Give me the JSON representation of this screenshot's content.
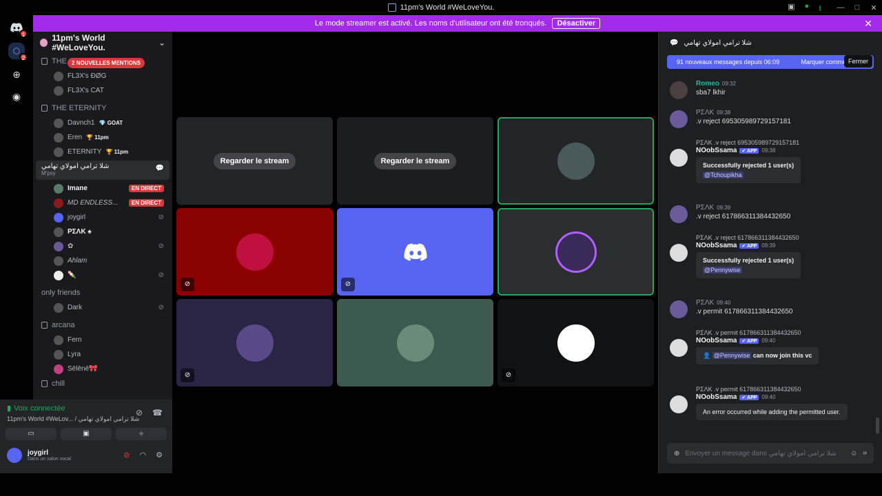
{
  "window": {
    "title": "11pm's World #WeLoveYou.",
    "controls": [
      "—",
      "□",
      "✕"
    ]
  },
  "banner": {
    "text": "Le mode streamer est activé. Les noms d'utilisateur ont été tronqués.",
    "button": "Désactiver",
    "close": "✕"
  },
  "servers": {
    "badges": [
      "1",
      "2"
    ],
    "home_badge": "1"
  },
  "channels": {
    "server_name": "11pm's World #WeLoveYou.",
    "mentions_badge": "2 NOUVELLES MENTIONS",
    "cat_partial": "THE ...",
    "cat1_users": [
      "FL3X's ÐØG",
      "FL3X's CAT"
    ],
    "cat2": "THE ETERNITY",
    "cat2_users": [
      {
        "name": "Davnch1",
        "tag": "💎 GOAT"
      },
      {
        "name": "Eren",
        "tag": "🏆 11pm"
      },
      {
        "name": "ETERNITY",
        "tag": "🏆 11pm"
      }
    ],
    "voice_channel": {
      "name": "شلا ترامي امولاي تهامي",
      "status": "M'psy"
    },
    "voice_users": [
      {
        "name": "Imane",
        "badge": "EN DIRECT"
      },
      {
        "name": "MD ENDLESS...",
        "badge": "EN DIRECT"
      },
      {
        "name": "joygirl"
      },
      {
        "name": "ΡΣΛΚ ♠"
      },
      {
        "name": "✿"
      },
      {
        "name": "Ahlam"
      },
      {
        "name": "🍡"
      }
    ],
    "cat3": "only friends",
    "cat3_users": [
      "Dark"
    ],
    "cat4": "arcana",
    "cat4_users": [
      "Fern",
      "Lyra",
      "Sēlēnē🎀"
    ],
    "cat5": "chill"
  },
  "voice_status": {
    "title": "Voix connectée",
    "sub": "11pm's World #WeLov... / شلا ترامي امولاي تهامي"
  },
  "user_panel": {
    "name": "joygirl",
    "status": "Dans un salon vocal"
  },
  "stage": {
    "watch_label": "Regarder le stream"
  },
  "chat": {
    "title": "شلا ترامي امولاي تهامي",
    "new_messages": "91 nouveaux messages depuis 06:09",
    "mark_read": "Marquer comme",
    "tooltip": "Fermer",
    "messages": [
      {
        "author": "Romeo",
        "time": "09:32",
        "text": "sba7 lkhir"
      },
      {
        "author": "ΡΣΛΚ",
        "time": "09:38",
        "text": ".v reject 695305989729157181"
      },
      {
        "reply": "ΡΣΛΚ .v reject 695305989729157181",
        "author": "NOobSsama",
        "app": "✔ APP",
        "time": "09:38",
        "embed_title": "Successfully rejected 1 user(s)",
        "embed_mention": "@Tchoupikha"
      },
      {
        "author": "ΡΣΛΚ",
        "time": "09:39",
        "text": ".v reject 617866311384432650"
      },
      {
        "reply": "ΡΣΛΚ .v reject 617866311384432650",
        "author": "NOobSsama",
        "app": "✔ APP",
        "time": "09:39",
        "embed_title": "Successfully rejected 1 user(s)",
        "embed_mention": "@Pennywise"
      },
      {
        "author": "ΡΣΛΚ",
        "time": "09:40",
        "text": ".v permit 617866311384432650"
      },
      {
        "reply": "ΡΣΛΚ .v permit 617866311384432650",
        "author": "NOobSsama",
        "app": "✔ APP",
        "time": "09:40",
        "embed_mention": "@Pennywise",
        "embed_text": "can now join this vc"
      },
      {
        "reply": "ΡΣΛΚ .v permit 617866311384432650",
        "author": "NOobSsama",
        "app": "✔ APP",
        "time": "09:40",
        "embed_text": "An error occurred while adding the permitted user."
      }
    ],
    "input_placeholder": "Envoyer un message dans شلا ترامي امولاي تهامي"
  },
  "colors": {
    "accent": "#5865f2",
    "banner": "#a12be8",
    "live": "#da373c",
    "voice_green": "#23a55a"
  }
}
